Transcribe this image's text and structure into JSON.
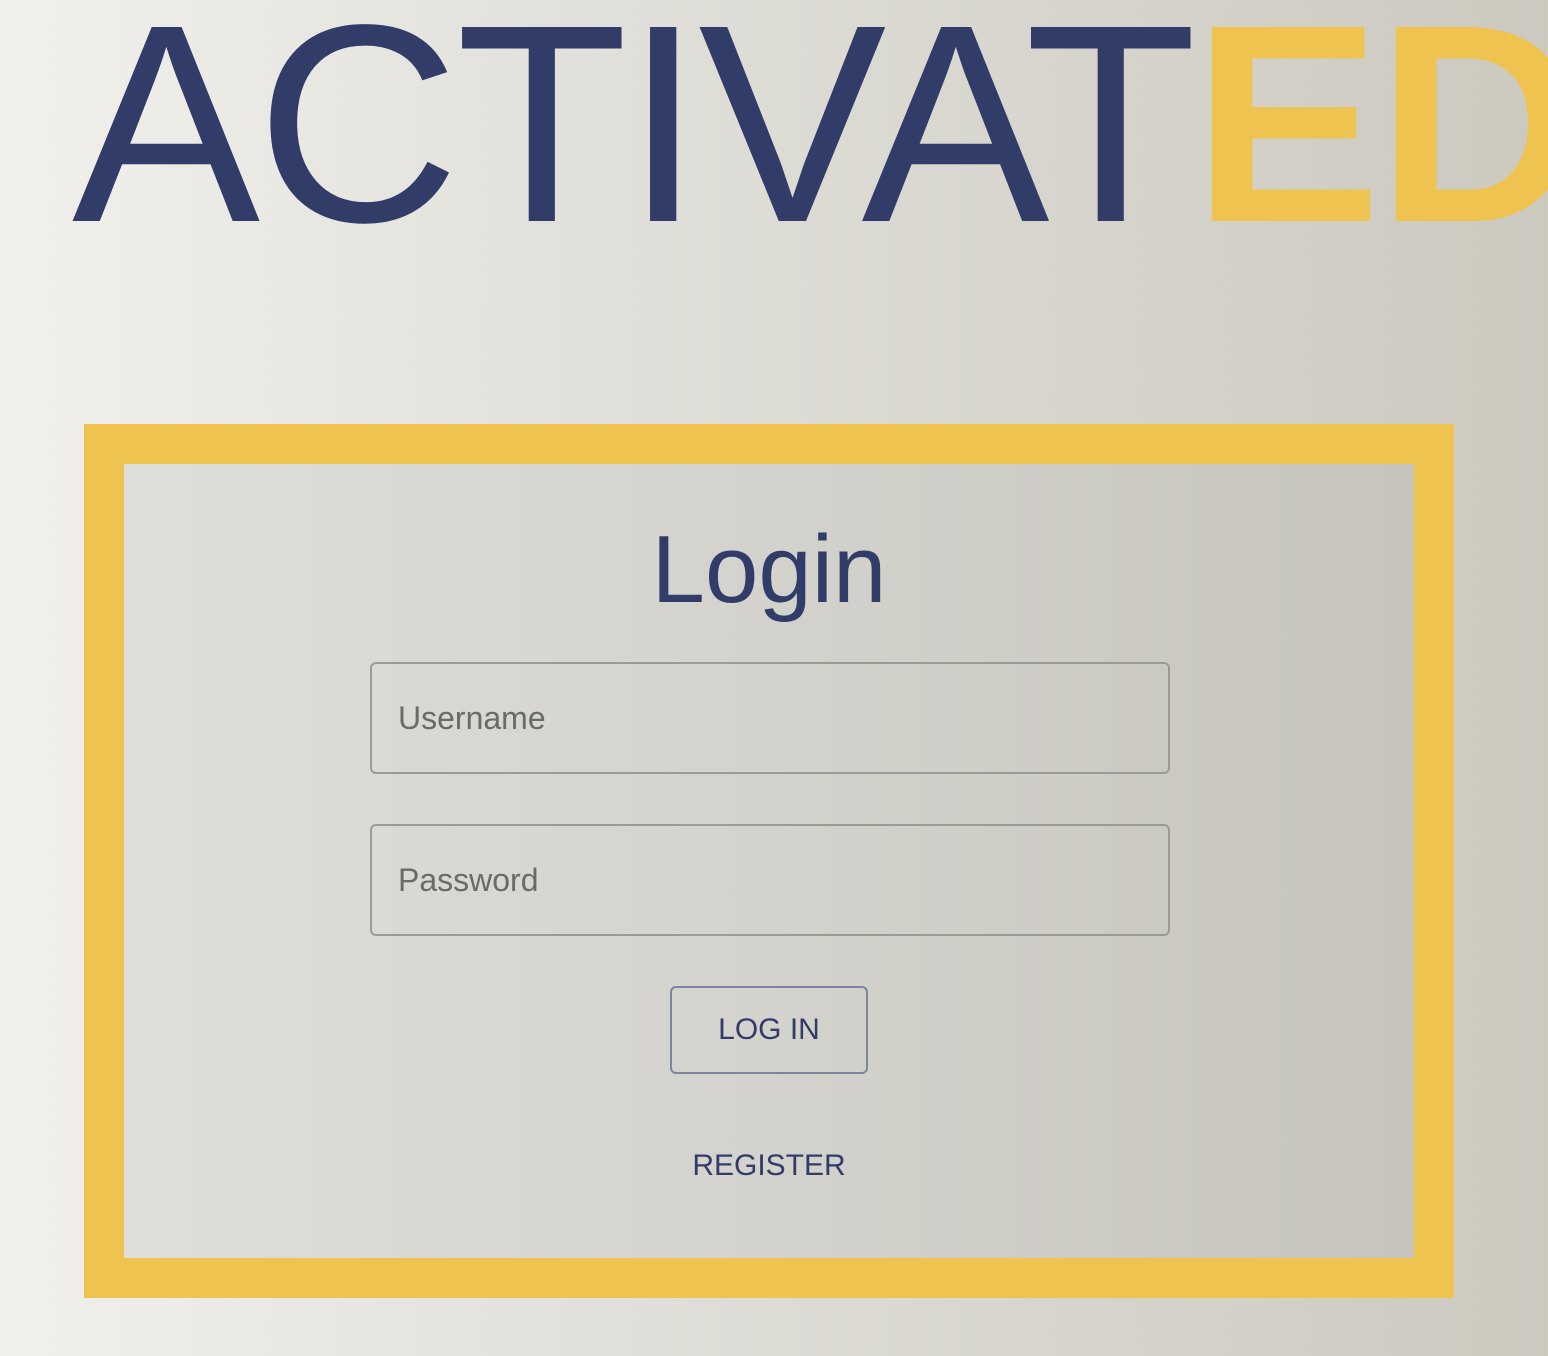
{
  "logo": {
    "part_a": "ACTIVAT",
    "part_b": "ED"
  },
  "colors": {
    "navy": "#313c69",
    "gold": "#efc34f"
  },
  "form": {
    "title": "Login",
    "username_placeholder": "Username",
    "password_placeholder": "Password",
    "login_button": "LOG IN",
    "register_link": "REGISTER"
  }
}
